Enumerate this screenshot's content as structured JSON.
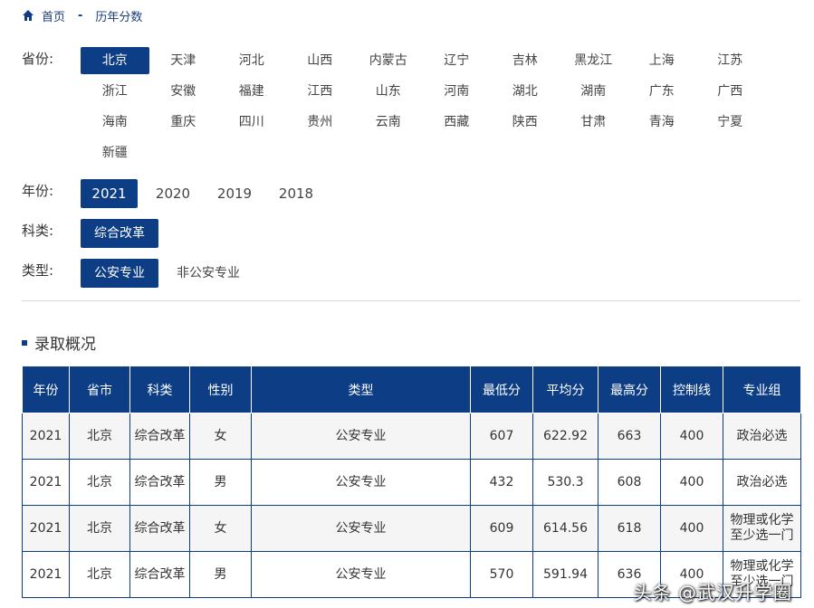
{
  "breadcrumb": {
    "home": "首页",
    "sep": "-",
    "current": "历年分数"
  },
  "filters": {
    "province": {
      "label": "省份:",
      "options": [
        "北京",
        "天津",
        "河北",
        "山西",
        "内蒙古",
        "辽宁",
        "吉林",
        "黑龙江",
        "上海",
        "江苏",
        "浙江",
        "安徽",
        "福建",
        "江西",
        "山东",
        "河南",
        "湖北",
        "湖南",
        "广东",
        "广西",
        "海南",
        "重庆",
        "四川",
        "贵州",
        "云南",
        "西藏",
        "陕西",
        "甘肃",
        "青海",
        "宁夏",
        "新疆"
      ],
      "selected": 0
    },
    "year": {
      "label": "年份:",
      "options": [
        "2021",
        "2020",
        "2019",
        "2018"
      ],
      "selected": 0
    },
    "subject": {
      "label": "科类:",
      "options": [
        "综合改革"
      ],
      "selected": 0
    },
    "type": {
      "label": "类型:",
      "options": [
        "公安专业",
        "非公安专业"
      ],
      "selected": 0
    }
  },
  "section": {
    "title": "录取概况"
  },
  "table": {
    "headers": [
      "年份",
      "省市",
      "科类",
      "性别",
      "类型",
      "最低分",
      "平均分",
      "最高分",
      "控制线",
      "专业组"
    ],
    "rows": [
      [
        "2021",
        "北京",
        "综合改革",
        "女",
        "公安专业",
        "607",
        "622.92",
        "663",
        "400",
        "政治必选"
      ],
      [
        "2021",
        "北京",
        "综合改革",
        "男",
        "公安专业",
        "432",
        "530.3",
        "608",
        "400",
        "政治必选"
      ],
      [
        "2021",
        "北京",
        "综合改革",
        "女",
        "公安专业",
        "609",
        "614.56",
        "618",
        "400",
        "物理或化学至少选一门"
      ],
      [
        "2021",
        "北京",
        "综合改革",
        "男",
        "公安专业",
        "570",
        "591.94",
        "636",
        "400",
        "物理或化学至少选一门"
      ]
    ]
  },
  "watermark": "头条 @武汉升学圈",
  "colors": {
    "primary": "#0d3d85"
  }
}
